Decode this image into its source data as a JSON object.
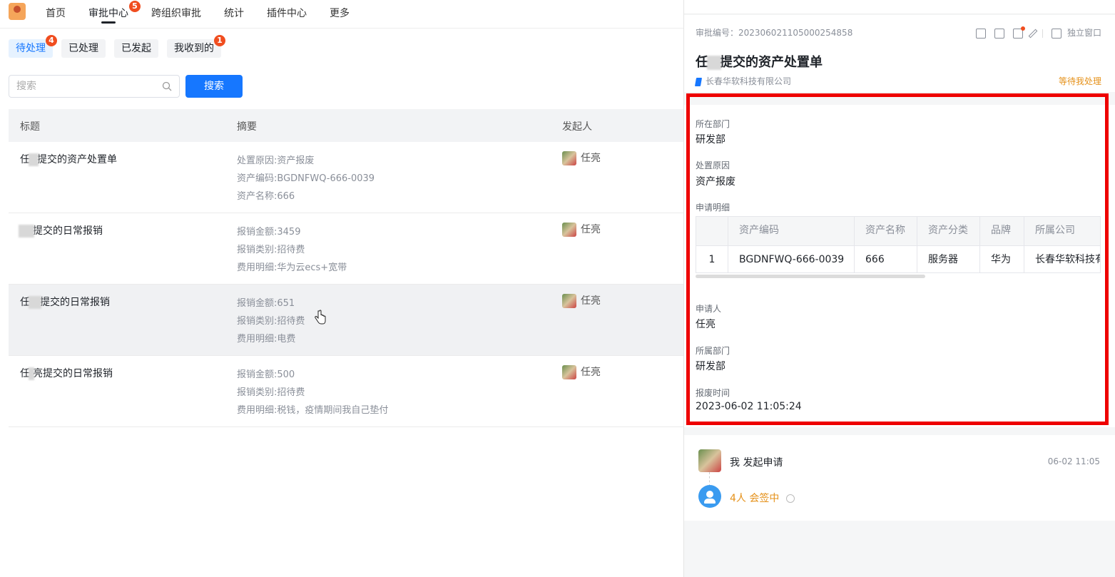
{
  "nav": {
    "items": [
      "首页",
      "审批中心",
      "跨组织审批",
      "统计",
      "插件中心",
      "更多"
    ],
    "approval_badge": "5"
  },
  "filters": {
    "items": [
      "待处理",
      "已处理",
      "已发起",
      "我收到的"
    ],
    "pending_badge": "4",
    "received_badge": "1"
  },
  "search": {
    "placeholder": "搜索",
    "button": "搜索"
  },
  "table": {
    "headers": [
      "标题",
      "摘要",
      "发起人"
    ],
    "rows": [
      {
        "title_prefix": "任",
        "title_suffix": "提交的资产处置单",
        "summary": [
          "处置原因:资产报废",
          "资产编码:BGDNFWQ-666-0039",
          "资产名称:666"
        ],
        "initiator": "任亮"
      },
      {
        "title_prefix": "",
        "title_suffix": "提交的日常报销",
        "summary": [
          "报销金额:3459",
          "报销类别:招待费",
          "费用明细:华为云ecs+宽带"
        ],
        "initiator": "任亮"
      },
      {
        "title_prefix": "任",
        "title_suffix": "提交的日常报销",
        "summary": [
          "报销金额:651",
          "报销类别:招待费",
          "费用明细:电费"
        ],
        "initiator": "任亮"
      },
      {
        "title_prefix": "任",
        "title_suffix": "亮提交的日常报销",
        "summary": [
          "报销金额:500",
          "报销类别:招待费",
          "费用明细:税钱，疫情期间我自己垫付"
        ],
        "initiator": "任亮"
      }
    ]
  },
  "detail": {
    "approval_no": "审批编号：20230602110500025485 8",
    "approval_no_text": "审批编号：202306021105000254858",
    "open_window": "独立窗口",
    "title_prefix": "任",
    "title_suffix": "提交的资产处置单",
    "company": "长春华软科技有限公司",
    "status": "等待我处理",
    "fields": {
      "dept_label": "所在部门",
      "dept_value": "研发部",
      "reason_label": "处置原因",
      "reason_value": "资产报废",
      "detail_label": "申请明细",
      "applicant_label": "申请人",
      "applicant_value": "任亮",
      "belong_dept_label": "所属部门",
      "belong_dept_value": "研发部",
      "scrap_time_label": "报废时间",
      "scrap_time_value": "2023-06-02 11:05:24"
    },
    "detail_table": {
      "headers": [
        "",
        "资产编码",
        "资产名称",
        "资产分类",
        "品牌",
        "所属公司"
      ],
      "row": [
        "1",
        "BGDNFWQ-666-0039",
        "666",
        "服务器",
        "华为",
        "长春华软科技有"
      ]
    },
    "flow": {
      "step1_text": "我  发起申请",
      "step1_time": "06-02 11:05",
      "step2_text": "4人  会签中"
    }
  }
}
